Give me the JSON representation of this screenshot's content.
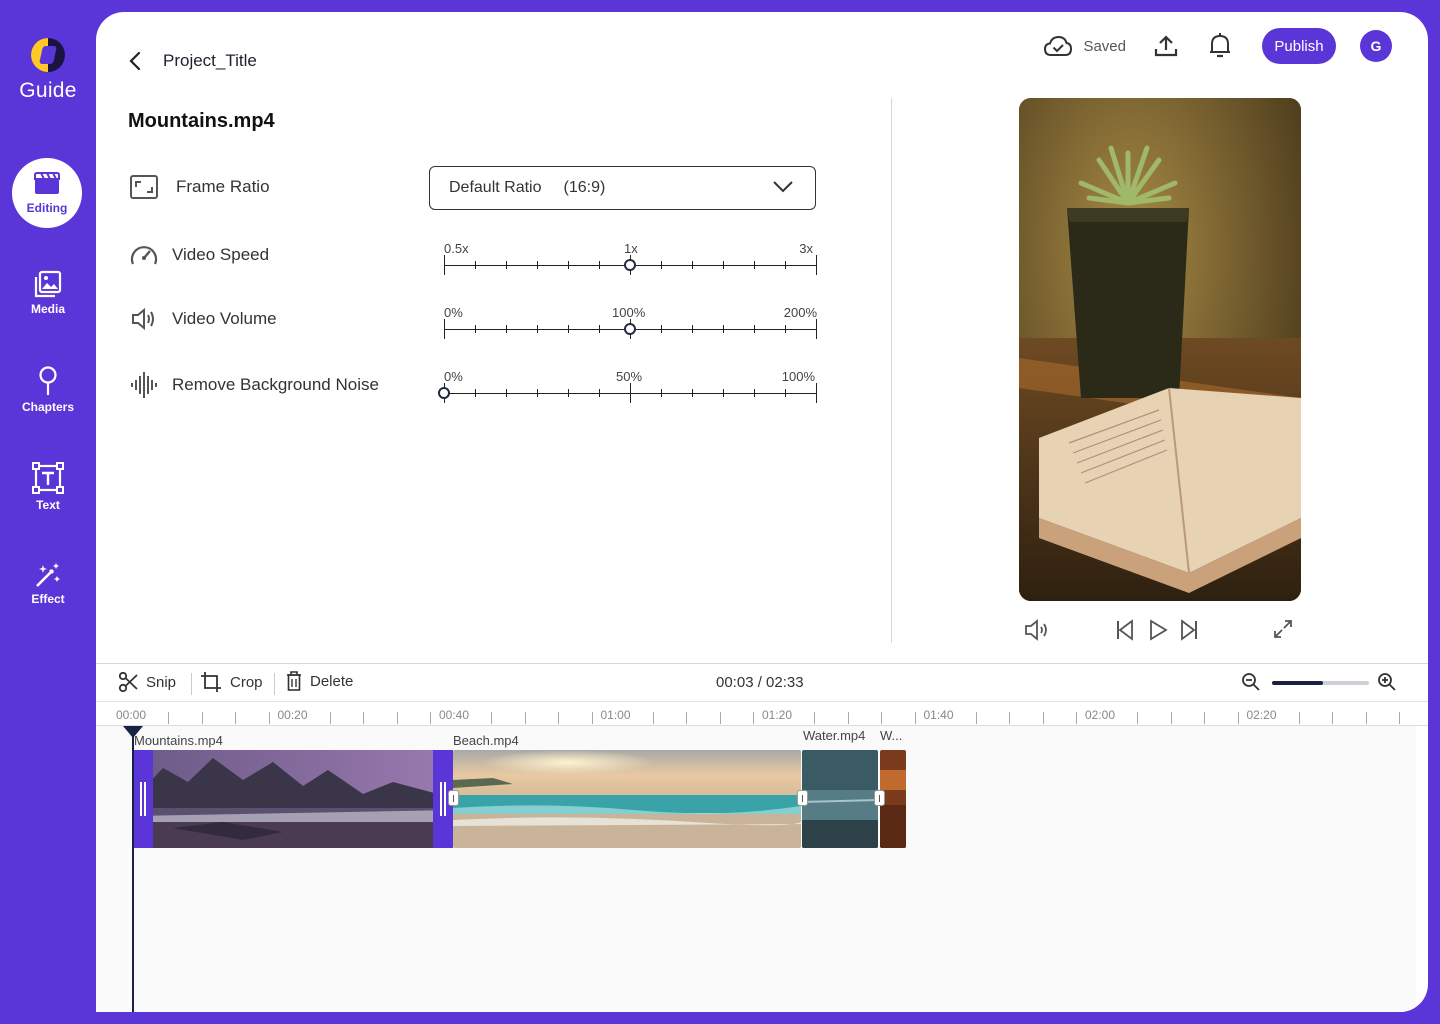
{
  "brand": {
    "name": "Guide"
  },
  "nav": [
    {
      "id": "editing",
      "label": "Editing",
      "icon": "clapperboard-icon",
      "active": true
    },
    {
      "id": "media",
      "label": "Media",
      "icon": "image-gallery-icon"
    },
    {
      "id": "chapters",
      "label": "Chapters",
      "icon": "location-pin-icon"
    },
    {
      "id": "text",
      "label": "Text",
      "icon": "text-box-icon"
    },
    {
      "id": "effect",
      "label": "Effect",
      "icon": "magic-wand-icon"
    }
  ],
  "header": {
    "project_title": "Project_Title",
    "saved_label": "Saved",
    "publish_label": "Publish",
    "avatar_initial": "G"
  },
  "settings": {
    "file_name": "Mountains.mp4",
    "frame_ratio": {
      "label": "Frame Ratio",
      "value": "Default Ratio",
      "ratio": "(16:9)"
    },
    "video_speed": {
      "label": "Video Speed",
      "min": "0.5x",
      "mid": "1x",
      "max": "3x",
      "position": 0.5
    },
    "video_volume": {
      "label": "Video Volume",
      "min": "0%",
      "mid": "100%",
      "max": "200%",
      "position": 0.5
    },
    "noise": {
      "label": "Remove Background Noise",
      "min": "0%",
      "mid": "50%",
      "max": "100%",
      "position": 0.0
    }
  },
  "timeline": {
    "tools": {
      "snip": "Snip",
      "crop": "Crop",
      "delete": "Delete"
    },
    "timecode": "00:03 / 02:33",
    "zoom_level": 0.53,
    "ruler_labels": [
      "00:00",
      "00:20",
      "00:40",
      "01:00",
      "01:20",
      "01:40",
      "02:00",
      "02:20"
    ],
    "clips": [
      {
        "name": "Mountains.mp4"
      },
      {
        "name": "Beach.mp4"
      },
      {
        "name": "Water.mp4"
      },
      {
        "name": "W..."
      }
    ]
  },
  "colors": {
    "accent": "#5a35d8",
    "dark": "#1a2244"
  }
}
